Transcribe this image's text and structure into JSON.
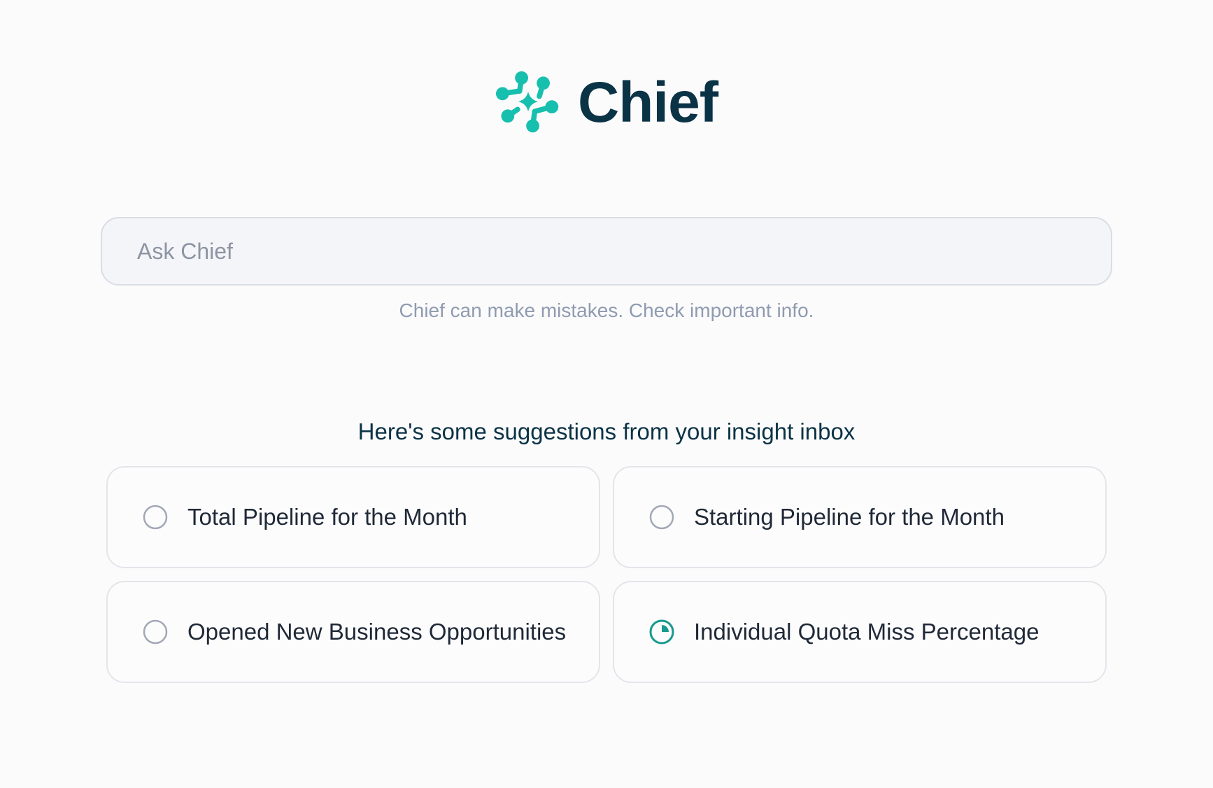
{
  "brand": {
    "name": "Chief",
    "mark_color": "#17bfae",
    "text_color": "#0b3346"
  },
  "search": {
    "placeholder": "Ask Chief",
    "value": ""
  },
  "disclaimer": "Chief can make mistakes. Check important info.",
  "suggestions": {
    "heading": "Here's some suggestions from your insight inbox",
    "items": [
      {
        "label": "Total Pipeline for the Month",
        "status_icon": "empty-circle-icon"
      },
      {
        "label": "Starting Pipeline for the Month",
        "status_icon": "empty-circle-icon"
      },
      {
        "label": "Opened New Business Opportunities",
        "status_icon": "empty-circle-icon"
      },
      {
        "label": "Individual Quota Miss Percentage",
        "status_icon": "loading-pie-icon",
        "accent_color": "#179a8e"
      }
    ]
  }
}
